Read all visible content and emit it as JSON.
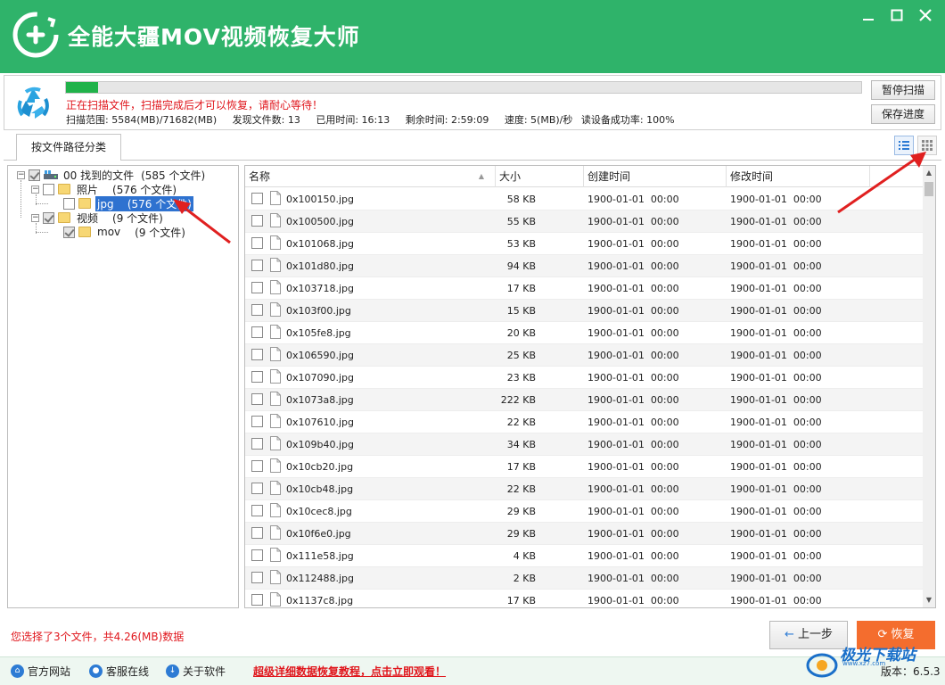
{
  "app": {
    "title": "全能大疆MOV视频恢复大师",
    "colors": {
      "brand": "#2fb36a",
      "accent_red": "#e0161c",
      "recover_orange": "#f46d2e",
      "selection_blue": "#2e72d0"
    }
  },
  "window_controls": [
    "minimize-icon",
    "maximize-icon",
    "close-icon"
  ],
  "scan": {
    "progress_fraction": 0.04,
    "message": "正在扫描文件，扫描完成后才可以恢复，请耐心等待！",
    "range": "扫描范围: 5584(MB)/71682(MB)",
    "found": "发现文件数: 13",
    "elapsed": "已用时间: 16:13",
    "remaining": "剩余时间: 2:59:09",
    "speed": "速度: 5(MB)/秒",
    "success_rate": "读设备成功率: 100%",
    "pause_label": "暂停扫描",
    "save_label": "保存进度"
  },
  "tab": {
    "label": "按文件路径分类"
  },
  "view_buttons": [
    "list-view-icon",
    "grid-view-icon"
  ],
  "tree": {
    "root": {
      "expander": "−",
      "label": "00 找到的文件",
      "count": "(585 个文件)",
      "checked": true
    },
    "photos": {
      "expander": "−",
      "label": "照片",
      "count": "(576 个文件)",
      "checked": false
    },
    "jpg": {
      "label": "jpg",
      "count": "(576 个文件)",
      "checked": false
    },
    "videos": {
      "expander": "−",
      "label": "视频",
      "count": "(9 个文件)",
      "checked": true
    },
    "mov": {
      "label": "mov",
      "count": "(9 个文件)",
      "checked": true
    }
  },
  "list": {
    "headers": {
      "name": "名称",
      "size": "大小",
      "created": "创建时间",
      "modified": "修改时间"
    },
    "rows": [
      {
        "name": "0x100150.jpg",
        "size": "58 KB",
        "created": "1900-01-01  00:00",
        "modified": "1900-01-01  00:00"
      },
      {
        "name": "0x100500.jpg",
        "size": "55 KB",
        "created": "1900-01-01  00:00",
        "modified": "1900-01-01  00:00"
      },
      {
        "name": "0x101068.jpg",
        "size": "53 KB",
        "created": "1900-01-01  00:00",
        "modified": "1900-01-01  00:00"
      },
      {
        "name": "0x101d80.jpg",
        "size": "94 KB",
        "created": "1900-01-01  00:00",
        "modified": "1900-01-01  00:00"
      },
      {
        "name": "0x103718.jpg",
        "size": "17 KB",
        "created": "1900-01-01  00:00",
        "modified": "1900-01-01  00:00"
      },
      {
        "name": "0x103f00.jpg",
        "size": "15 KB",
        "created": "1900-01-01  00:00",
        "modified": "1900-01-01  00:00"
      },
      {
        "name": "0x105fe8.jpg",
        "size": "20 KB",
        "created": "1900-01-01  00:00",
        "modified": "1900-01-01  00:00"
      },
      {
        "name": "0x106590.jpg",
        "size": "25 KB",
        "created": "1900-01-01  00:00",
        "modified": "1900-01-01  00:00"
      },
      {
        "name": "0x107090.jpg",
        "size": "23 KB",
        "created": "1900-01-01  00:00",
        "modified": "1900-01-01  00:00"
      },
      {
        "name": "0x1073a8.jpg",
        "size": "222 KB",
        "created": "1900-01-01  00:00",
        "modified": "1900-01-01  00:00"
      },
      {
        "name": "0x107610.jpg",
        "size": "22 KB",
        "created": "1900-01-01  00:00",
        "modified": "1900-01-01  00:00"
      },
      {
        "name": "0x109b40.jpg",
        "size": "34 KB",
        "created": "1900-01-01  00:00",
        "modified": "1900-01-01  00:00"
      },
      {
        "name": "0x10cb20.jpg",
        "size": "17 KB",
        "created": "1900-01-01  00:00",
        "modified": "1900-01-01  00:00"
      },
      {
        "name": "0x10cb48.jpg",
        "size": "22 KB",
        "created": "1900-01-01  00:00",
        "modified": "1900-01-01  00:00"
      },
      {
        "name": "0x10cec8.jpg",
        "size": "29 KB",
        "created": "1900-01-01  00:00",
        "modified": "1900-01-01  00:00"
      },
      {
        "name": "0x10f6e0.jpg",
        "size": "29 KB",
        "created": "1900-01-01  00:00",
        "modified": "1900-01-01  00:00"
      },
      {
        "name": "0x111e58.jpg",
        "size": "4 KB",
        "created": "1900-01-01  00:00",
        "modified": "1900-01-01  00:00"
      },
      {
        "name": "0x112488.jpg",
        "size": "2 KB",
        "created": "1900-01-01  00:00",
        "modified": "1900-01-01  00:00"
      },
      {
        "name": "0x1137c8.jpg",
        "size": "17 KB",
        "created": "1900-01-01  00:00",
        "modified": "1900-01-01  00:00"
      }
    ]
  },
  "footer": {
    "selection_info": "您选择了3个文件，共4.26(MB)数据",
    "prev_label": "上一步",
    "recover_label": "恢复"
  },
  "bottombar": {
    "website": "官方网站",
    "support": "客服在线",
    "about": "关于软件",
    "tutorial": "超级详细数据恢复教程，点击立即观看！",
    "version": "版本：6.5.3"
  },
  "watermark": {
    "text": "极光下载站",
    "sub": "www.xz7.com"
  }
}
